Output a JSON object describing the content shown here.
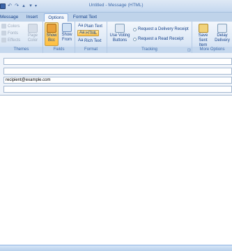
{
  "window": {
    "title": "Untitled - Message (HTML)"
  },
  "tabs": [
    {
      "label": "Message"
    },
    {
      "label": "Insert"
    },
    {
      "label": "Options"
    },
    {
      "label": "Format Text"
    }
  ],
  "ribbon": {
    "themes": {
      "label": "Themes",
      "colors": "Colors",
      "fonts": "Fonts",
      "effects": "Effects",
      "page_color_1": "Page",
      "page_color_2": "Color"
    },
    "fields": {
      "label": "Fields",
      "show_bcc_1": "Show",
      "show_bcc_2": "Bcc",
      "show_from_1": "Show",
      "show_from_2": "From"
    },
    "format": {
      "label": "Format",
      "plain_text": "Plain Text",
      "html": "HTML",
      "rich_text": "Rich Text"
    },
    "tracking": {
      "label": "Tracking",
      "voting_1": "Use Voting",
      "voting_2": "Buttons",
      "delivery_receipt": "Request a Delivery Receipt",
      "read_receipt": "Request a Read Receipt"
    },
    "more_options": {
      "label": "More Options",
      "save_sent_1": "Save Sent",
      "save_sent_2": "Item",
      "delay_1": "Delay",
      "delay_2": "Delivery"
    }
  },
  "message": {
    "to": "",
    "cc": "",
    "bcc": "recipient@example.com",
    "subject": ""
  },
  "colors": {
    "accent": "#15428b",
    "active_button": "#ffc24a",
    "ribbon_bg": "#dbe7f5"
  }
}
